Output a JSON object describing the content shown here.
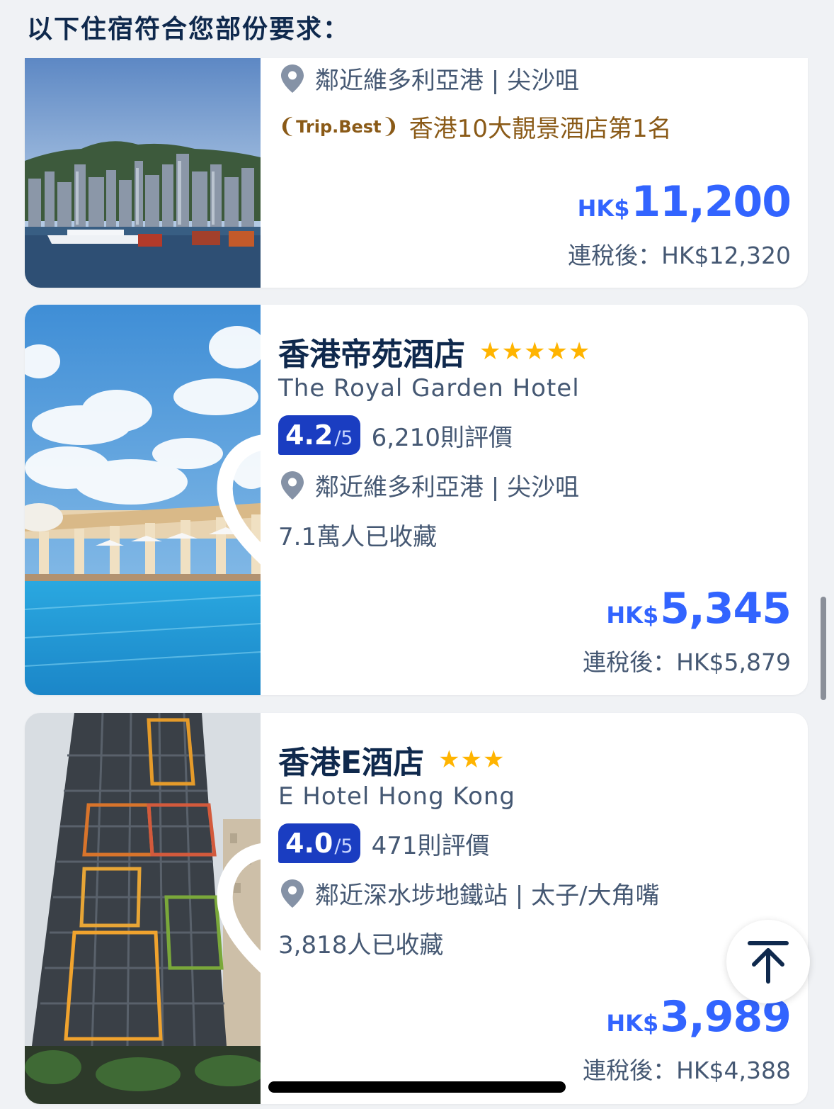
{
  "header": {
    "title": "以下住宿符合您部份要求："
  },
  "hotels": [
    {
      "location": "鄰近維多利亞港 | 尖沙咀",
      "award_badge": "Trip.Best",
      "award_text": "香港10大靚景酒店第1名",
      "price_currency": "HK$",
      "price_amount": "11,200",
      "tax_price": "連稅後：HK$12,320",
      "photo": "harbour-skyline"
    },
    {
      "name": "香港帝苑酒店",
      "stars": "★★★★★",
      "star_count": 5,
      "en_name": "The Royal Garden Hotel",
      "score": "4.2",
      "score_max": "/5",
      "reviews": "6,210則評價",
      "location": "鄰近維多利亞港 | 尖沙咀",
      "saved": "7.1萬人已收藏",
      "price_currency": "HK$",
      "price_amount": "5,345",
      "tax_price": "連稅後：HK$5,879",
      "photo": "rooftop-pool",
      "favorite_icon": "heart-outline-icon"
    },
    {
      "name": "香港E酒店",
      "stars": "★★★",
      "star_count": 3,
      "en_name": "E Hotel Hong Kong",
      "score": "4.0",
      "score_max": "/5",
      "reviews": "471則評價",
      "location": "鄰近深水埗地鐵站 | 太子/大角嘴",
      "saved": "3,818人已收藏",
      "price_currency": "HK$",
      "price_amount": "3,989",
      "tax_price": "連稅後：HK$4,388",
      "photo": "building-facade",
      "favorite_icon": "heart-outline-icon"
    }
  ],
  "controls": {
    "scroll_top_icon": "arrow-up-to-top-icon"
  },
  "colors": {
    "price": "#3264ff",
    "score_badge": "#1a3dc1",
    "stars": "#ffb400",
    "text_primary": "#0f294d",
    "text_secondary": "#455873",
    "award": "#8a5a17"
  }
}
